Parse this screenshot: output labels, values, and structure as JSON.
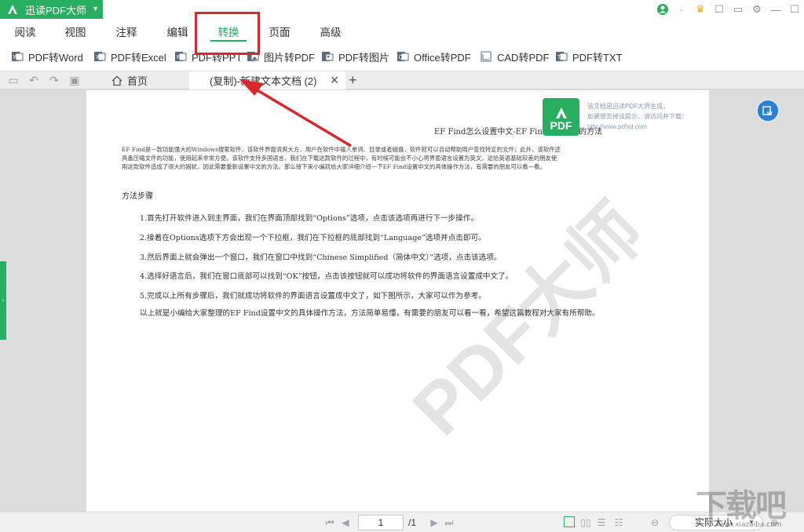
{
  "app": {
    "name": "迅读PDF大师"
  },
  "menu": [
    {
      "label": "阅读"
    },
    {
      "label": "视图"
    },
    {
      "label": "注释"
    },
    {
      "label": "编辑"
    },
    {
      "label": "转换",
      "active": true
    },
    {
      "label": "页面"
    },
    {
      "label": "高级"
    }
  ],
  "toolbar": [
    {
      "label": "PDF转Word",
      "icon": "word-icon"
    },
    {
      "label": "PDF转Excel",
      "icon": "excel-icon"
    },
    {
      "label": "PDF转PPT",
      "icon": "ppt-icon"
    },
    {
      "label": "图片转PDF",
      "icon": "image-icon"
    },
    {
      "label": "PDF转图片",
      "icon": "picture-icon"
    },
    {
      "label": "Office转PDF",
      "icon": "office-icon"
    },
    {
      "label": "CAD转PDF",
      "icon": "cad-icon"
    },
    {
      "label": "PDF转TXT",
      "icon": "txt-icon"
    }
  ],
  "tabs": {
    "home_label": "首页",
    "active_label": "(复制)-新建文本文档 (2)"
  },
  "document": {
    "title": "EF Find怎么设置中文-EF Find设置中文的方法",
    "intro": "EF Find是一款功能强大的Windows搜索软件，该软件界面清爽大方，用户在软件中输入单词、目录或者磁盘，软件就可以自动帮助用户查找特定的文件；此外，该软件还具备压缩文件的功能，使用起来非常方便。该软件支持多国语言，我们在下载这款软件的过程中，有时候可能会不小心将界面语言设置为英文，这给英语基础较差的朋友使用这款软件造成了很大的困扰，因此需要重新设置中文的方法。那么接下来小编就给大家详细介绍一下EF Find设置中文的具体操作方法，有需要的朋友可以看一看。",
    "section": "方法步骤",
    "steps": [
      "1.首先打开软件进入到主界面，我们在界面顶部找到“Options”选项，点击该选项再进行下一步操作。",
      "2.接着在Options选项下方会出现一个下拉框，我们在下拉框的底部找到“Language”选项并点击即可。",
      "3.然后界面上就会弹出一个窗口，我们在窗口中找到“Chinese Simplified（简体中文）”选项，点击该选项。",
      "4.选择好语言后，我们在窗口底部可以找到“OK”按钮，点击该按钮就可以成功将软件的界面语言设置成中文了。",
      "5.完成以上所有步骤后，我们就成功将软件的界面语言设置成中文了，如下图所示，大家可以作为参考。"
    ],
    "summary": "以上就是小编给大家整理的EF Find设置中文的具体操作方法，方法简单易懂，有需要的朋友可以看一看，希望这篇教程对大家有所帮助。",
    "badge_text": "PDF",
    "watermark_note_line1": "该文档是迅读PDF大师生成，",
    "watermark_note_line2": "如果想去掉该提示，请访问并下载：",
    "watermark_url": "http://www.pdfxd.com",
    "watermark_big": "PDF大师"
  },
  "statusbar": {
    "page_current": "1",
    "page_total": "/1",
    "zoom": "实际大小"
  },
  "site_watermark": {
    "text": "下载吧",
    "url": "www.xiazaiba.com"
  },
  "colors": {
    "brand": "#27ae60",
    "annotation": "#d8272d"
  }
}
